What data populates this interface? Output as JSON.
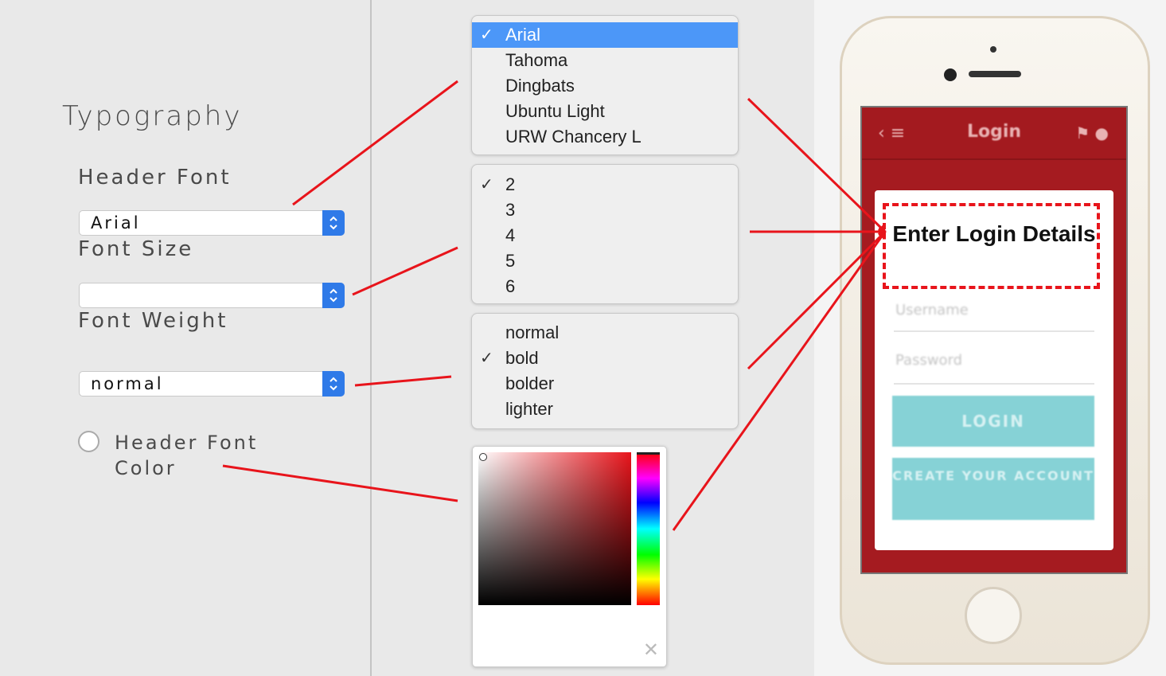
{
  "settings": {
    "title": "Typography",
    "header_font_label": "Header Font",
    "header_font_value": "Arial",
    "font_size_label": "Font Size",
    "font_size_value": "",
    "font_weight_label": "Font Weight",
    "font_weight_value": "normal",
    "header_font_color_label": "Header Font Color"
  },
  "font_menu": {
    "items": [
      "Arial",
      "Tahoma",
      "Dingbats",
      "Ubuntu Light",
      "URW Chancery L"
    ],
    "selected_index": 0
  },
  "size_menu": {
    "items": [
      "2",
      "3",
      "4",
      "5",
      "6"
    ],
    "selected_index": 0
  },
  "weight_menu": {
    "items": [
      "normal",
      "bold",
      "bolder",
      "lighter"
    ],
    "selected_index": 1
  },
  "color_picker": {
    "hue_color": "#e8141b",
    "close_label": "✕"
  },
  "phone": {
    "screen_title": "Login",
    "card_title": "Enter Login Details",
    "username_placeholder": "Username",
    "password_placeholder": "Password",
    "login_button": "LOGIN",
    "create_button": "CREATE YOUR ACCOUNT"
  },
  "colors": {
    "accent_blue": "#2f7ae8",
    "menu_selected": "#4c97f8",
    "annotation_red": "#e8141b",
    "app_red": "#a51b20",
    "button_teal": "#86d2d6"
  }
}
